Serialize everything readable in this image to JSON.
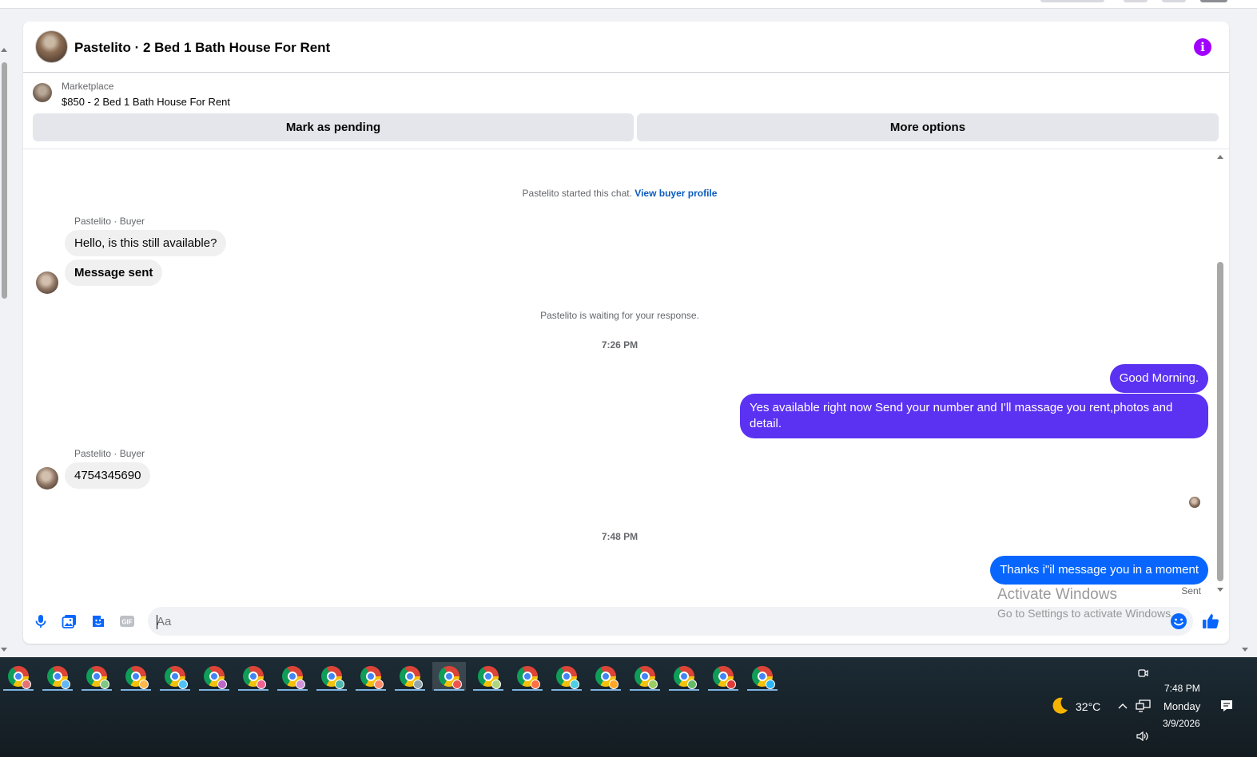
{
  "header": {
    "title": "Pastelito · 2 Bed 1 Bath House For Rent",
    "info_icon": "info-icon",
    "info_glyph": "i",
    "accent": "#a100ff"
  },
  "listing": {
    "label": "Marketplace",
    "title": "$850 - 2 Bed 1 Bath House For Rent",
    "buttons": {
      "mark_pending": "Mark as pending",
      "more_options": "More options"
    }
  },
  "chat": {
    "started_prefix": "Pastelito started this chat.",
    "view_buyer_profile": "View buyer profile",
    "sender_1": "Pastelito · Buyer",
    "msg_1": "Hello, is this still available?",
    "msg_2": "Message sent",
    "waiting": "Pastelito is waiting for your response.",
    "time_1": "7:26 PM",
    "out_1": "Good Morning.",
    "out_2": "Yes available right now Send your number and I'll massage you rent,photos and detail.",
    "sender_2": "Pastelito · Buyer",
    "msg_3": "4754345690",
    "time_2": "7:48 PM",
    "out_3": "Thanks i\"il message you in a moment",
    "sent_status": "Sent",
    "colors": {
      "outgoing_purple": "#5b32f2",
      "outgoing_blue": "#0866ff",
      "incoming": "#f0f0f0"
    }
  },
  "composer": {
    "placeholder": "Aa",
    "icons": [
      "microphone-icon",
      "photo-icon",
      "sticker-icon",
      "gif-icon",
      "emoji-icon",
      "thumbs-up-icon"
    ],
    "gif_label": "GIF"
  },
  "watermark": {
    "line1": "Activate Windows",
    "line2": "Go to Settings to activate Windows."
  },
  "taskbar": {
    "apps": [
      {
        "name": "chrome-profile-1",
        "profile_color": "#e57373"
      },
      {
        "name": "chrome-profile-2",
        "profile_color": "#64b5f6"
      },
      {
        "name": "chrome-profile-3",
        "profile_color": "#81c784"
      },
      {
        "name": "chrome-profile-4",
        "profile_color": "#ffb74d"
      },
      {
        "name": "chrome-profile-5",
        "profile_color": "#4fc3f7"
      },
      {
        "name": "chrome-profile-6",
        "profile_color": "#ba68c8"
      },
      {
        "name": "chrome-profile-7",
        "profile_color": "#f06292"
      },
      {
        "name": "chrome-profile-8",
        "profile_color": "#ce93d8"
      },
      {
        "name": "chrome-profile-9",
        "profile_color": "#4db6ac"
      },
      {
        "name": "chrome-profile-10",
        "profile_color": "#ff8a65"
      },
      {
        "name": "chrome-profile-11",
        "profile_color": "#90a4ae"
      },
      {
        "name": "chrome-profile-12",
        "profile_color": "#ef5350"
      },
      {
        "name": "chrome-profile-13",
        "profile_color": "#aed581"
      },
      {
        "name": "chrome-profile-14",
        "profile_color": "#ff7043"
      },
      {
        "name": "chrome-profile-15",
        "profile_color": "#4dd0e1"
      },
      {
        "name": "chrome-profile-16",
        "profile_color": "#ffa726"
      },
      {
        "name": "chrome-profile-17",
        "profile_color": "#9ccc65"
      },
      {
        "name": "chrome-profile-18",
        "profile_color": "#66bb6a"
      },
      {
        "name": "chrome-profile-19",
        "profile_color": "#e53935"
      },
      {
        "name": "chrome-profile-20",
        "profile_color": "#29b6f6"
      }
    ],
    "active_index": 11,
    "weather": {
      "icon": "moon-icon",
      "temp": "32°C"
    },
    "clock": {
      "time": "7:48 PM",
      "day": "Monday",
      "date": "3/9/2026"
    },
    "tray_icons": [
      "chevron-up-icon",
      "network-icon",
      "volume-icon",
      "meet-now-icon",
      "notifications-icon"
    ]
  }
}
